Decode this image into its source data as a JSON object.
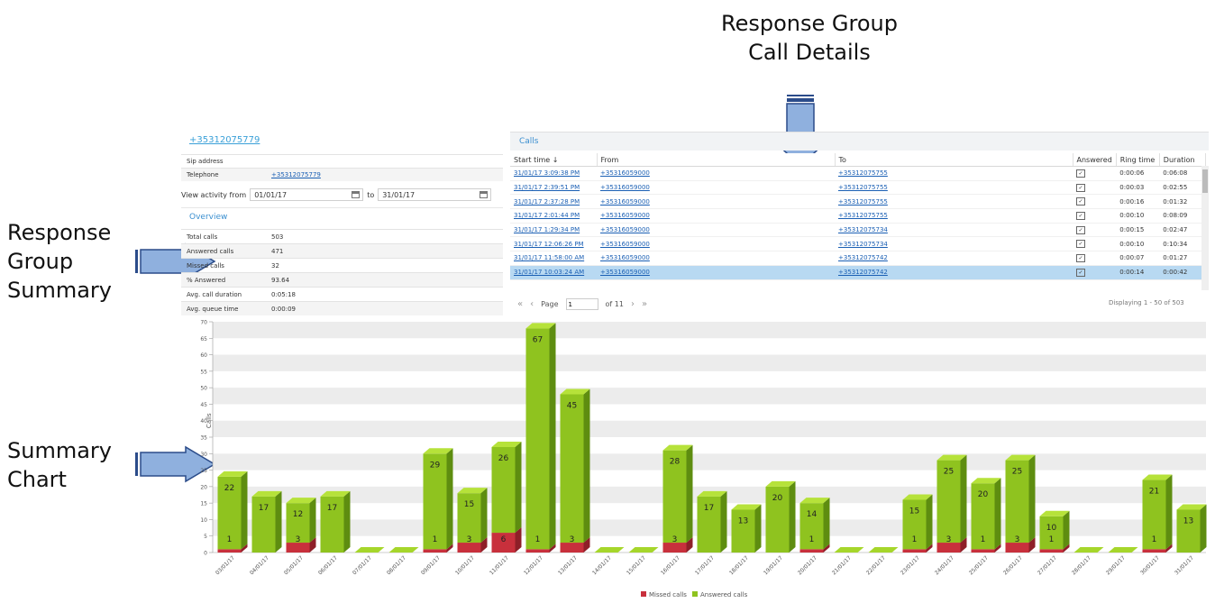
{
  "annotations": {
    "details": [
      "Response Group",
      "Call Details"
    ],
    "summary": [
      "Response",
      "Group",
      "Summary"
    ],
    "chart": [
      "Summary",
      "Chart"
    ]
  },
  "group": {
    "number_link": "+35312075779",
    "rows": [
      {
        "label": "Sip address",
        "value": ""
      },
      {
        "label": "Telephone",
        "value": "+35312075779"
      }
    ]
  },
  "activity": {
    "label": "View activity from",
    "from": "01/01/17",
    "to_label": "to",
    "to": "31/01/17"
  },
  "overview": {
    "title": "Overview",
    "rows": [
      {
        "label": "Total calls",
        "value": "503"
      },
      {
        "label": "Answered calls",
        "value": "471"
      },
      {
        "label": "Missed calls",
        "value": "32"
      },
      {
        "label": "% Answered",
        "value": "93.64"
      },
      {
        "label": "Avg. call duration",
        "value": "0:05:18"
      },
      {
        "label": "Avg. queue time",
        "value": "0:00:09"
      }
    ]
  },
  "calls": {
    "title": "Calls",
    "columns": [
      "Start time ↓",
      "From",
      "To",
      "Answered",
      "Ring time",
      "Duration"
    ],
    "rows": [
      [
        "31/01/17 3:09:38 PM",
        "+35316059000",
        "+35312075755",
        "0:00:06",
        "0:06:08"
      ],
      [
        "31/01/17 2:39:51 PM",
        "+35316059000",
        "+35312075755",
        "0:00:03",
        "0:02:55"
      ],
      [
        "31/01/17 2:37:28 PM",
        "+35316059000",
        "+35312075755",
        "0:00:16",
        "0:01:32"
      ],
      [
        "31/01/17 2:01:44 PM",
        "+35316059000",
        "+35312075755",
        "0:00:10",
        "0:08:09"
      ],
      [
        "31/01/17 1:29:34 PM",
        "+35316059000",
        "+35312075734",
        "0:00:15",
        "0:02:47"
      ],
      [
        "31/01/17 12:06:26 PM",
        "+35316059000",
        "+35312075734",
        "0:00:10",
        "0:10:34"
      ],
      [
        "31/01/17 11:58:00 AM",
        "+35316059000",
        "+35312075742",
        "0:00:07",
        "0:01:27"
      ],
      [
        "31/01/17 10:03:24 AM",
        "+35316059000",
        "+35312075742",
        "0:00:14",
        "0:00:42"
      ]
    ],
    "selected_row": 7,
    "pager": {
      "page_label": "Page",
      "page": "1",
      "of_label": "of 11",
      "display": "Displaying 1 - 50 of 503"
    }
  },
  "chart_data": {
    "type": "bar",
    "stacked": true,
    "ylabel": "Calls",
    "ylim": [
      0,
      70
    ],
    "yticks": [
      0,
      5,
      10,
      15,
      20,
      25,
      30,
      35,
      40,
      45,
      50,
      55,
      60,
      65,
      70
    ],
    "categories": [
      "03/01/17",
      "04/01/17",
      "05/01/17",
      "06/01/17",
      "07/01/17",
      "08/01/17",
      "09/01/17",
      "10/01/17",
      "11/01/17",
      "12/01/17",
      "13/01/17",
      "14/01/17",
      "15/01/17",
      "16/01/17",
      "17/01/17",
      "18/01/17",
      "19/01/17",
      "20/01/17",
      "21/01/17",
      "22/01/17",
      "23/01/17",
      "24/01/17",
      "25/01/17",
      "26/01/17",
      "27/01/17",
      "28/01/17",
      "29/01/17",
      "30/01/17",
      "31/01/17"
    ],
    "series": [
      {
        "name": "Missed calls",
        "color": "#c8303c",
        "values": [
          1,
          0,
          3,
          0,
          0,
          0,
          1,
          3,
          6,
          1,
          3,
          0,
          0,
          3,
          0,
          0,
          0,
          1,
          0,
          0,
          1,
          3,
          1,
          3,
          1,
          0,
          0,
          1,
          0
        ]
      },
      {
        "name": "Answered calls",
        "color": "#8fc31f",
        "values": [
          22,
          17,
          12,
          17,
          0,
          0,
          29,
          15,
          26,
          67,
          45,
          0,
          0,
          28,
          17,
          13,
          20,
          14,
          0,
          0,
          15,
          25,
          20,
          25,
          10,
          0,
          0,
          21,
          13
        ]
      }
    ],
    "legend": "bottom"
  }
}
